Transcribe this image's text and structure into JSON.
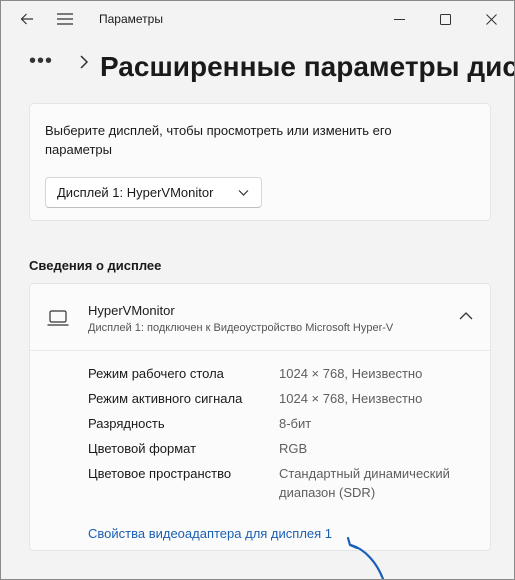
{
  "window": {
    "title": "Параметры"
  },
  "breadcrumb": {
    "more": "•••",
    "page_title": "Расширенные параметры дисплея"
  },
  "display_select": {
    "description": "Выберите дисплей, чтобы просмотреть или изменить его параметры",
    "selected": "Дисплей 1: HyperVMonitor"
  },
  "section": {
    "title": "Сведения о дисплее"
  },
  "monitor": {
    "name": "HyperVMonitor",
    "subtitle": "Дисплей 1: подключен к Видеоустройство Microsoft Hyper-V",
    "properties": [
      {
        "label": "Режим рабочего стола",
        "value": "1024 × 768, Неизвестно"
      },
      {
        "label": "Режим активного сигнала",
        "value": "1024 × 768, Неизвестно"
      },
      {
        "label": "Разрядность",
        "value": "8-бит"
      },
      {
        "label": "Цветовой формат",
        "value": "RGB"
      },
      {
        "label": "Цветовое пространство",
        "value": "Стандартный динамический диапазон (SDR)"
      }
    ],
    "adapter_link": "Свойства видеоадаптера для дисплея 1"
  },
  "colors": {
    "accent": "#1a5fb4",
    "annotation_arrow": "#1a5fb4",
    "background": "#f3f3f3",
    "card": "#fbfbfb"
  },
  "icons": {
    "back": "arrow-left-icon",
    "menu": "hamburger-icon",
    "minimize": "minimize-icon",
    "maximize": "maximize-icon",
    "close": "close-icon",
    "breadcrumb_separator": "chevron-right-icon",
    "dropdown": "chevron-down-icon",
    "monitor": "laptop-icon",
    "collapse": "chevron-up-icon"
  }
}
